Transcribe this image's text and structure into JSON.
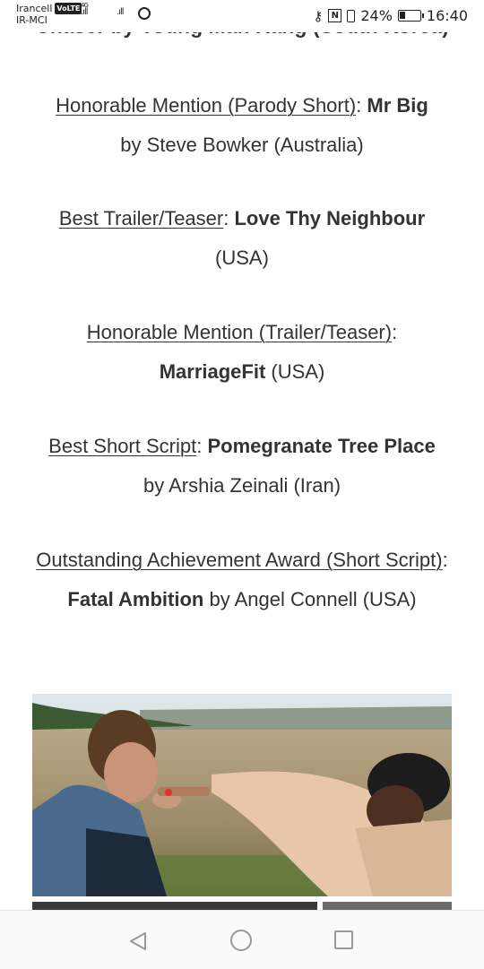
{
  "status_bar": {
    "carrier1": "Irancell",
    "volte": "VoLTE",
    "carrier2": "IR-MCI",
    "network": "4G",
    "battery": "24%",
    "time": "16:40",
    "icons": [
      "key-icon",
      "nfc-icon",
      "vibrate-icon",
      "battery-icon",
      "whatsapp-icon",
      "signal-icon"
    ]
  },
  "article": {
    "cut_line": "Chaser by Young Man Kang (South Korea)",
    "awards": [
      {
        "category": "Honorable Mention (Parody Short)",
        "sep": ": ",
        "title": "Mr Big",
        "rest": " by Steve Bowker (Australia)"
      },
      {
        "category": "Best Trailer/Teaser",
        "sep": ": ",
        "title": "Love Thy Neighbour",
        "rest": " (USA)"
      },
      {
        "category": "Honorable Mention (Trailer/Teaser)",
        "sep": ": ",
        "title": "MarriageFit",
        "rest": " (USA)"
      },
      {
        "category": "Best Short Script",
        "sep": ": ",
        "title": "Pomegranate Tree Place",
        "rest": " by Arshia Zeinali (Iran)"
      },
      {
        "category": "Outstanding Achievement Award (Short Script)",
        "sep": ": ",
        "title": "Fatal Ambition",
        "rest": " by Angel Connell (USA)"
      }
    ]
  },
  "nav": {
    "icons": [
      "back-icon",
      "home-icon",
      "recents-icon"
    ]
  }
}
